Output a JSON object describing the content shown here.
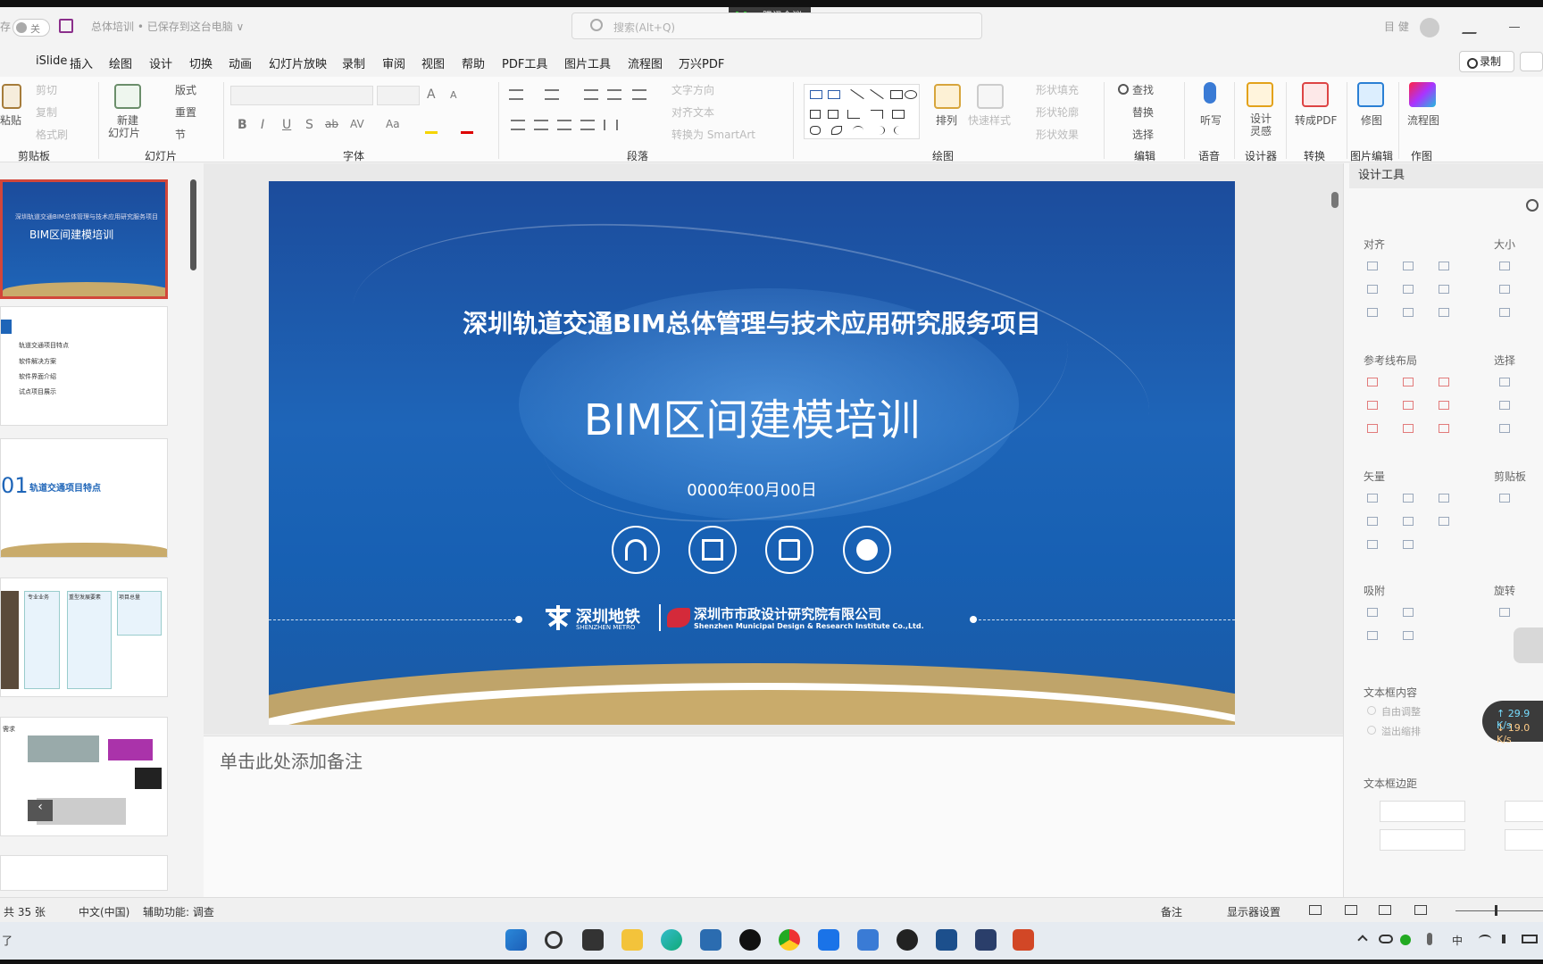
{
  "titlebar": {
    "save_left": "存",
    "autosave_state": "关",
    "doc_title": "总体培训 • 已保存到这台电脑 ∨",
    "search_placeholder": "搜索(Alt+Q)",
    "meeting_label": "腾讯会议",
    "right_text": "目 健"
  },
  "tabs": [
    "iSlide",
    "插入",
    "绘图",
    "设计",
    "切换",
    "动画",
    "幻灯片放映",
    "录制",
    "审阅",
    "视图",
    "帮助",
    "PDF工具",
    "图片工具",
    "流程图",
    "万兴PDF"
  ],
  "record_button": "录制",
  "ribbon": {
    "clipboard": {
      "paste": "粘贴",
      "cut": "剪切",
      "copy": "复制",
      "format_painter": "格式刷",
      "label": "剪贴板"
    },
    "slides": {
      "new_slide": "新建",
      "new_slide2": "幻灯片",
      "layout": "版式",
      "reset": "重置",
      "section": "节",
      "label": "幻灯片"
    },
    "font": {
      "label": "字体",
      "bold": "B",
      "italic": "I",
      "underline": "U",
      "shadow": "S",
      "strike": "ab",
      "spacing": "AV",
      "case": "Aa",
      "grow": "A",
      "shrink": "A"
    },
    "paragraph": {
      "text_direction": "文字方向",
      "align_text": "对齐文本",
      "smartart": "转换为 SmartArt",
      "label": "段落"
    },
    "drawing": {
      "arrange": "排列",
      "quick_styles": "快速样式",
      "fill": "形状填充",
      "outline": "形状轮廓",
      "effects": "形状效果",
      "label": "绘图"
    },
    "editing": {
      "find": "查找",
      "replace": "替换",
      "select": "选择",
      "label": "编辑"
    },
    "voice": {
      "dictate": "听写",
      "label": "语音"
    },
    "designer": {
      "designer_ideas": "设计",
      "designer_ideas2": "灵感",
      "label": "设计器"
    },
    "convert": {
      "to_pdf": "转成PDF",
      "label": "转换"
    },
    "image_edit": {
      "retouch": "修图",
      "label": "图片编辑"
    },
    "draw": {
      "flowchart": "流程图",
      "label": "作图"
    }
  },
  "thumbnails": [
    {
      "title": "BIM区间建模培训",
      "subtitle": "深圳轨道交通BIM总体管理与技术应用研究服务项目"
    },
    {
      "items": [
        "轨道交通项目特点",
        "软件解决方案",
        "软件界面介绍",
        "试点项目展示"
      ]
    },
    {
      "number": "01",
      "heading": "轨道交通项目特点"
    },
    {
      "labels": [
        "专业业务",
        "重型发展要素",
        "项目总量"
      ]
    },
    {
      "labels": [
        "需求"
      ]
    }
  ],
  "slide": {
    "subtitle": "深圳轨道交通BIM总体管理与技术应用研究服务项目",
    "title": "BIM区间建模培训",
    "date": "0000年00月00日",
    "logo1": "深圳地铁",
    "logo1_en": "SHENZHEN METRO",
    "logo2": "深圳市市政设计研究院有限公司",
    "logo2_en": "Shenzhen Municipal Design & Research Institute Co.,Ltd.",
    "icons": [
      "people-icon",
      "document-icon",
      "edit-icon",
      "chart-icon"
    ]
  },
  "notes_placeholder": "单击此处添加备注",
  "design_tools": {
    "title": "设计工具",
    "align": "对齐",
    "size": "大小",
    "guides": "参考线布局",
    "select": "选择",
    "vector": "矢量",
    "clipboard": "剪贴板",
    "snap": "吸附",
    "rotate": "旋转",
    "textbox_content": "文本框内容",
    "autofit": "自由调整",
    "overflow": "溢出缩排",
    "textbox_margin": "文本框边距"
  },
  "network": {
    "up": "↑ 29.9 K/s",
    "down": "↓ 19.0 K/s"
  },
  "statusbar": {
    "slides_count": "共 35 张",
    "language": "中文(中国)",
    "accessibility": "辅助功能: 调查",
    "notes": "备注",
    "display_settings": "显示器设置"
  },
  "taskbar": {
    "left_text": "了",
    "ime": "中"
  },
  "colors": {
    "slide_blue": "#1e65b8",
    "accent_red": "#d2463a",
    "gold": "#c9ab6b"
  }
}
